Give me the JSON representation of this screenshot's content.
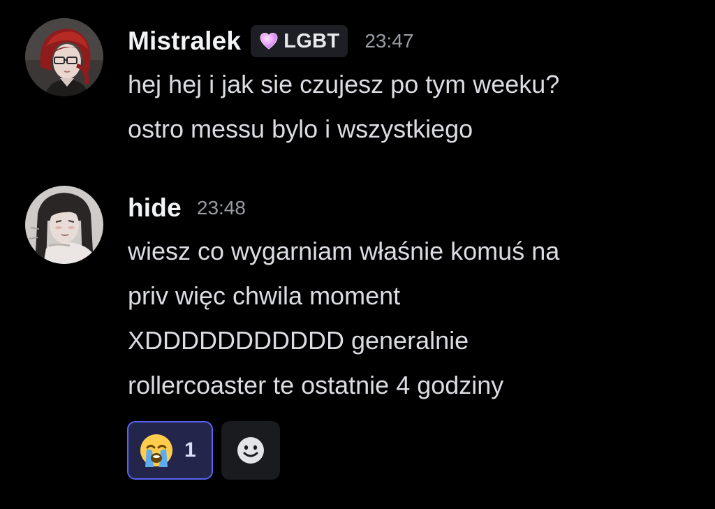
{
  "messages": [
    {
      "username": "Mistralek",
      "tag": {
        "label": "LGBT",
        "icon": "pink-heart-icon",
        "color": "#e7a3f7"
      },
      "timestamp": "23:47",
      "lines": [
        "hej hej i jak sie czujesz po tym weeku?",
        "ostro messu bylo i wszystkiego"
      ],
      "avatar": "avatar-red-hair-glasses"
    },
    {
      "username": "hide",
      "timestamp": "23:48",
      "lines": [
        "wiesz co wygarniam właśnie komuś na",
        "priv więc chwila moment",
        "XDDDDDDDDDDD generalnie",
        "rollercoaster te ostatnie 4 godziny"
      ],
      "avatar": "avatar-long-dark-hair",
      "reactions": [
        {
          "emoji": "😭",
          "icon": "loudly-crying-face-icon",
          "count": "1",
          "active": true
        },
        {
          "icon": "add-reaction-smiley-icon",
          "active": false
        }
      ]
    }
  ],
  "colors": {
    "background": "#000000",
    "accent": "#5865f2",
    "text": "#dcdde2",
    "muted": "#9a9ca4"
  }
}
